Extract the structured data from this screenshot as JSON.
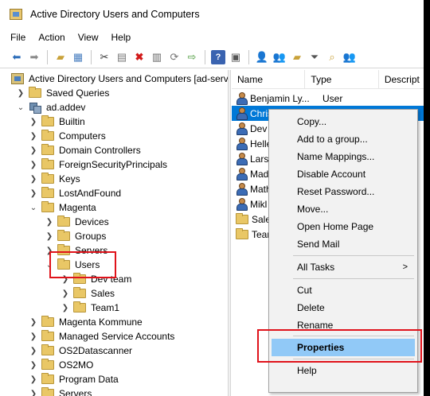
{
  "window": {
    "title": "Active Directory Users and Computers"
  },
  "menubar": [
    "File",
    "Action",
    "View",
    "Help"
  ],
  "toolbar": {
    "buttons": [
      "back-icon",
      "forward-icon",
      "up-folder-icon",
      "show-console-tree-icon",
      "cut-icon",
      "paste-icon",
      "delete-icon",
      "properties-icon",
      "refresh-icon",
      "export-list-icon",
      "help-icon",
      "console-icon",
      "new-user-icon",
      "new-group-icon",
      "new-ou-icon",
      "filter-icon",
      "find-icon",
      "add-to-group-icon"
    ]
  },
  "tree": {
    "root": "Active Directory Users and Computers [ad-serv",
    "saved_queries": "Saved Queries",
    "domain": "ad.addev",
    "items": [
      "Builtin",
      "Computers",
      "Domain Controllers",
      "ForeignSecurityPrincipals",
      "Keys",
      "LostAndFound",
      "Magenta"
    ],
    "magenta_children": [
      "Devices",
      "Groups",
      "Servers",
      "Users"
    ],
    "users_children": [
      "Dev team",
      "Sales",
      "Team1"
    ],
    "after_magenta": [
      "Magenta Kommune",
      "Managed Service Accounts",
      "OS2Datascanner",
      "OS2MO",
      "Program Data",
      "Servers"
    ]
  },
  "list": {
    "columns": [
      "Name",
      "Type",
      "Descript"
    ],
    "rows": [
      {
        "name": "Benjamin Ly...",
        "type": "User",
        "kind": "user"
      },
      {
        "name": "Chris",
        "type": "",
        "kind": "user",
        "selected": true
      },
      {
        "name": "Dev t",
        "type": "",
        "kind": "user"
      },
      {
        "name": "Helle",
        "type": "",
        "kind": "user"
      },
      {
        "name": "Lars",
        "type": "",
        "kind": "user"
      },
      {
        "name": "Mad",
        "type": "",
        "kind": "user"
      },
      {
        "name": "Math",
        "type": "",
        "kind": "user"
      },
      {
        "name": "Mikl",
        "type": "",
        "kind": "user"
      },
      {
        "name": "Sales",
        "type": "",
        "kind": "folder"
      },
      {
        "name": "Team",
        "type": "",
        "kind": "folder"
      }
    ]
  },
  "context_menu": {
    "items": [
      "Copy...",
      "Add to a group...",
      "Name Mappings...",
      "Disable Account",
      "Reset Password...",
      "Move...",
      "Open Home Page",
      "Send Mail",
      "All Tasks",
      "Cut",
      "Delete",
      "Rename",
      "Properties",
      "Help"
    ],
    "submenu_arrow": ">"
  },
  "colors": {
    "selection": "#0078d7",
    "menu_highlight": "#91c9f7",
    "annotation_box": "#e0131b"
  }
}
